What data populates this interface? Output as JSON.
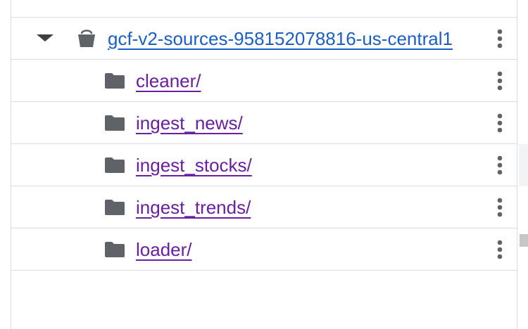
{
  "tree": {
    "bucket": {
      "name": "gcf-v2-sources-958152078816-us-central1",
      "icon": "bucket-icon",
      "expanded": true,
      "link_color": "#1a5fc8"
    },
    "folders": [
      {
        "name": "cleaner/",
        "icon": "folder-icon"
      },
      {
        "name": "ingest_news/",
        "icon": "folder-icon"
      },
      {
        "name": "ingest_stocks/",
        "icon": "folder-icon"
      },
      {
        "name": "ingest_trends/",
        "icon": "folder-icon"
      },
      {
        "name": "loader/",
        "icon": "folder-icon"
      }
    ],
    "folder_link_color": "#6a1ea1",
    "row_menu_icon": "more-vert-icon"
  }
}
